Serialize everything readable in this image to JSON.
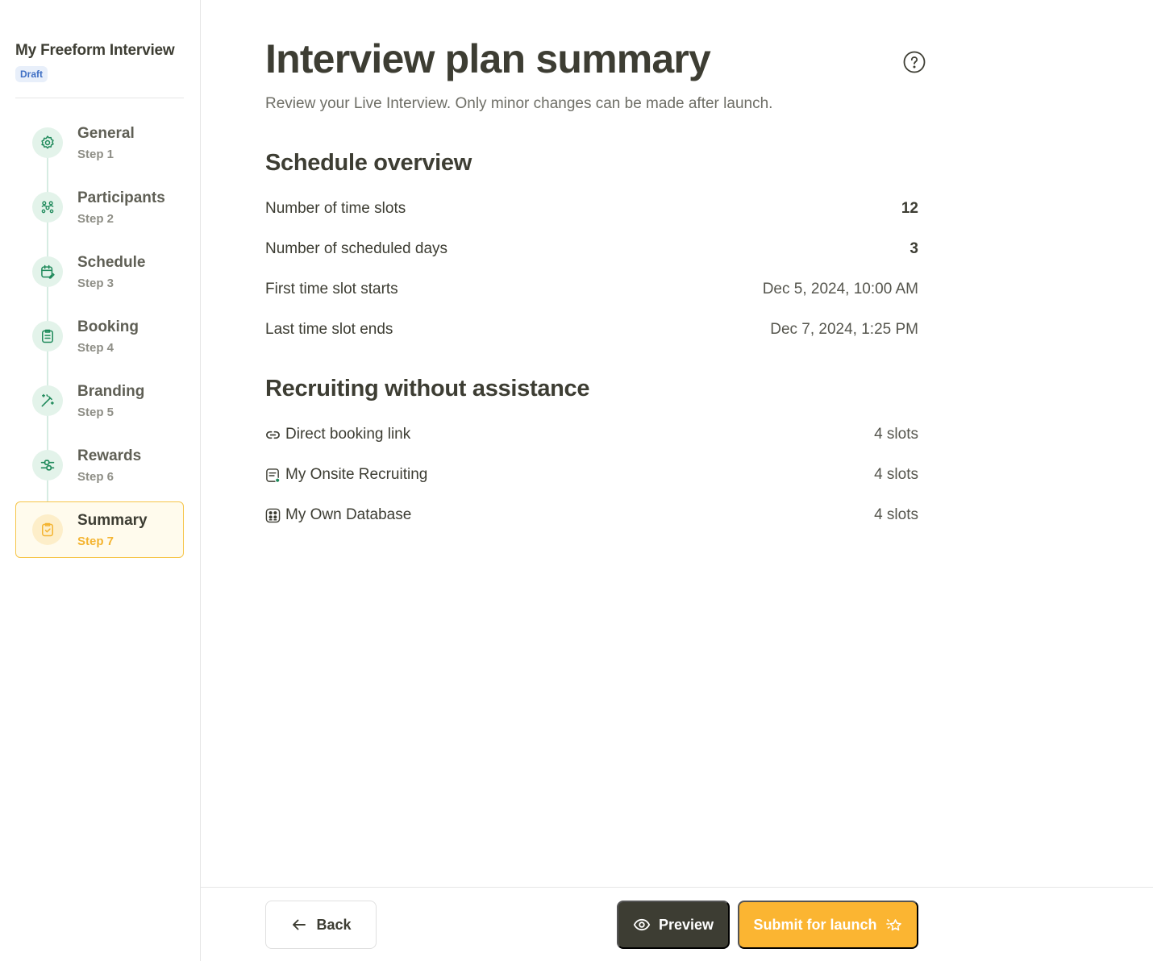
{
  "project": {
    "title": "My Freeform Interview",
    "status": "Draft"
  },
  "steps": [
    {
      "label": "General",
      "sub": "Step 1",
      "icon": "gear-icon"
    },
    {
      "label": "Participants",
      "sub": "Step 2",
      "icon": "people-icon"
    },
    {
      "label": "Schedule",
      "sub": "Step 3",
      "icon": "calendar-edit-icon"
    },
    {
      "label": "Booking",
      "sub": "Step 4",
      "icon": "clipboard-list-icon"
    },
    {
      "label": "Branding",
      "sub": "Step 5",
      "icon": "magic-wand-icon"
    },
    {
      "label": "Rewards",
      "sub": "Step 6",
      "icon": "sliders-icon"
    },
    {
      "label": "Summary",
      "sub": "Step 7",
      "icon": "clipboard-check-icon",
      "active": true
    }
  ],
  "page": {
    "title": "Interview plan summary",
    "subtitle": "Review your Live Interview. Only minor changes can be made after launch."
  },
  "schedule": {
    "title": "Schedule overview",
    "rows": [
      {
        "label": "Number of time slots",
        "value": "12"
      },
      {
        "label": "Number of scheduled days",
        "value": "3"
      },
      {
        "label": "First time slot starts",
        "value": "Dec 5, 2024, 10:00 AM"
      },
      {
        "label": "Last time slot ends",
        "value": "Dec 7, 2024, 1:25 PM"
      }
    ]
  },
  "recruiting": {
    "title": "Recruiting without assistance",
    "rows": [
      {
        "label": "Direct booking link",
        "value": "4 slots",
        "icon": "link-icon"
      },
      {
        "label": "My Onsite Recruiting",
        "value": "4 slots",
        "icon": "onsite-form-icon"
      },
      {
        "label": "My Own Database",
        "value": "4 slots",
        "icon": "database-people-icon"
      }
    ]
  },
  "footer": {
    "back": "Back",
    "preview": "Preview",
    "submit": "Submit for launch"
  },
  "colors": {
    "accent": "#fbb532",
    "dark": "#3d3d33",
    "green": "#1f8a5b",
    "draft_blue": "#3f6fc4"
  }
}
